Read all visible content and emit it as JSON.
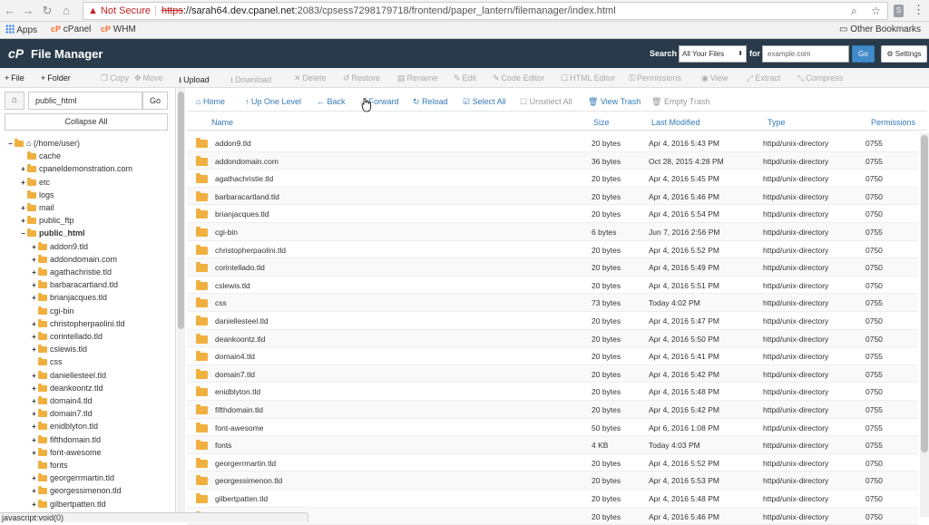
{
  "browser": {
    "warning": "Not Secure",
    "url_scheme": "https",
    "url_host": "://sarah64.dev.cpanel.net",
    "url_rest": ":2083/cpsess7298179718/frontend/paper_lantern/filemanager/index.html",
    "bookmarks": {
      "apps": "Apps",
      "cpanel": "cPanel",
      "whm": "WHM",
      "other": "Other Bookmarks"
    }
  },
  "header": {
    "logo": "cP",
    "title": "File Manager",
    "search_label": "Search",
    "search_scope": "All Your Files",
    "for_label": "for",
    "search_placeholder": "example.com",
    "go_label": "Go",
    "settings_label": "Settings"
  },
  "toolbar": {
    "items": [
      {
        "label": "File",
        "icon": "+",
        "enabled": true
      },
      {
        "label": "Folder",
        "icon": "+",
        "enabled": true
      },
      {
        "label": "Copy",
        "icon": "❐",
        "enabled": false
      },
      {
        "label": "Move",
        "icon": "✥",
        "enabled": false
      },
      {
        "label": "Upload",
        "icon": "⭳",
        "enabled": true
      },
      {
        "label": "Download",
        "icon": "⭳",
        "enabled": false
      },
      {
        "label": "Delete",
        "icon": "✕",
        "enabled": false
      },
      {
        "label": "Restore",
        "icon": "↺",
        "enabled": false
      },
      {
        "label": "Rename",
        "icon": "▤",
        "enabled": false
      },
      {
        "label": "Edit",
        "icon": "✎",
        "enabled": false
      },
      {
        "label": "Code Editor",
        "icon": "✎",
        "enabled": false
      },
      {
        "label": "HTML Editor",
        "icon": "☐",
        "enabled": false
      },
      {
        "label": "Permissions",
        "icon": "⚿",
        "enabled": false
      },
      {
        "label": "View",
        "icon": "◉",
        "enabled": false
      },
      {
        "label": "Extract",
        "icon": "⤢",
        "enabled": false
      },
      {
        "label": "Compress",
        "icon": "⤡",
        "enabled": false
      }
    ]
  },
  "sidebar": {
    "path_value": "public_html",
    "go_label": "Go",
    "collapse_label": "Collapse All",
    "tree": [
      {
        "label": "(/home/user)",
        "level": 0,
        "toggle": "−",
        "home": true
      },
      {
        "label": "cache",
        "level": 1,
        "toggle": ""
      },
      {
        "label": "cpaneldemonstration.com",
        "level": 1,
        "toggle": "+"
      },
      {
        "label": "etc",
        "level": 1,
        "toggle": "+"
      },
      {
        "label": "logs",
        "level": 1,
        "toggle": ""
      },
      {
        "label": "mail",
        "level": 1,
        "toggle": "+"
      },
      {
        "label": "public_ftp",
        "level": 1,
        "toggle": "+"
      },
      {
        "label": "public_html",
        "level": 1,
        "toggle": "−",
        "bold": true
      },
      {
        "label": "addon9.tld",
        "level": 2,
        "toggle": "+"
      },
      {
        "label": "addondomain.com",
        "level": 2,
        "toggle": "+"
      },
      {
        "label": "agathachristie.tld",
        "level": 2,
        "toggle": "+"
      },
      {
        "label": "barbaracartland.tld",
        "level": 2,
        "toggle": "+"
      },
      {
        "label": "brianjacques.tld",
        "level": 2,
        "toggle": "+"
      },
      {
        "label": "cgi-bin",
        "level": 2,
        "toggle": ""
      },
      {
        "label": "christopherpaolini.tld",
        "level": 2,
        "toggle": "+"
      },
      {
        "label": "corintellado.tld",
        "level": 2,
        "toggle": "+"
      },
      {
        "label": "cslewis.tld",
        "level": 2,
        "toggle": "+"
      },
      {
        "label": "css",
        "level": 2,
        "toggle": ""
      },
      {
        "label": "daniellesteel.tld",
        "level": 2,
        "toggle": "+"
      },
      {
        "label": "deankoontz.tld",
        "level": 2,
        "toggle": "+"
      },
      {
        "label": "domain4.tld",
        "level": 2,
        "toggle": "+"
      },
      {
        "label": "domain7.tld",
        "level": 2,
        "toggle": "+"
      },
      {
        "label": "enidblyton.tld",
        "level": 2,
        "toggle": "+"
      },
      {
        "label": "fifthdomain.tld",
        "level": 2,
        "toggle": "+"
      },
      {
        "label": "font-awesome",
        "level": 2,
        "toggle": "+"
      },
      {
        "label": "fonts",
        "level": 2,
        "toggle": ""
      },
      {
        "label": "georgerrmartin.tld",
        "level": 2,
        "toggle": "+"
      },
      {
        "label": "georgessimenon.tld",
        "level": 2,
        "toggle": "+"
      },
      {
        "label": "gilbertpatten.tld",
        "level": 2,
        "toggle": "+"
      }
    ]
  },
  "subbar": {
    "home": "Home",
    "up": "Up One Level",
    "back": "Back",
    "forward": "Forward",
    "reload": "Reload",
    "select_all": "Select All",
    "unselect_all": "Unselect All",
    "view_trash": "View Trash",
    "empty_trash": "Empty Trash"
  },
  "table": {
    "headers": {
      "name": "Name",
      "size": "Size",
      "modified": "Last Modified",
      "type": "Type",
      "perms": "Permissions"
    },
    "rows": [
      {
        "name": "addon9.tld",
        "size": "20 bytes",
        "modified": "Apr 4, 2016 5:43 PM",
        "type": "httpd/unix-directory",
        "perms": "0755"
      },
      {
        "name": "addondomain.com",
        "size": "36 bytes",
        "modified": "Oct 28, 2015 4:28 PM",
        "type": "httpd/unix-directory",
        "perms": "0755"
      },
      {
        "name": "agathachristie.tld",
        "size": "20 bytes",
        "modified": "Apr 4, 2016 5:45 PM",
        "type": "httpd/unix-directory",
        "perms": "0750"
      },
      {
        "name": "barbaracartland.tld",
        "size": "20 bytes",
        "modified": "Apr 4, 2016 5:46 PM",
        "type": "httpd/unix-directory",
        "perms": "0750"
      },
      {
        "name": "brianjacques.tld",
        "size": "20 bytes",
        "modified": "Apr 4, 2016 5:54 PM",
        "type": "httpd/unix-directory",
        "perms": "0750"
      },
      {
        "name": "cgi-bin",
        "size": "6 bytes",
        "modified": "Jun 7, 2016 2:56 PM",
        "type": "httpd/unix-directory",
        "perms": "0755"
      },
      {
        "name": "christopherpaolini.tld",
        "size": "20 bytes",
        "modified": "Apr 4, 2016 5:52 PM",
        "type": "httpd/unix-directory",
        "perms": "0750"
      },
      {
        "name": "corintellado.tld",
        "size": "20 bytes",
        "modified": "Apr 4, 2016 5:49 PM",
        "type": "httpd/unix-directory",
        "perms": "0750"
      },
      {
        "name": "cslewis.tld",
        "size": "20 bytes",
        "modified": "Apr 4, 2016 5:51 PM",
        "type": "httpd/unix-directory",
        "perms": "0750"
      },
      {
        "name": "css",
        "size": "73 bytes",
        "modified": "Today 4:02 PM",
        "type": "httpd/unix-directory",
        "perms": "0755"
      },
      {
        "name": "daniellesteel.tld",
        "size": "20 bytes",
        "modified": "Apr 4, 2016 5:47 PM",
        "type": "httpd/unix-directory",
        "perms": "0750"
      },
      {
        "name": "deankoontz.tld",
        "size": "20 bytes",
        "modified": "Apr 4, 2016 5:50 PM",
        "type": "httpd/unix-directory",
        "perms": "0750"
      },
      {
        "name": "domain4.tld",
        "size": "20 bytes",
        "modified": "Apr 4, 2016 5:41 PM",
        "type": "httpd/unix-directory",
        "perms": "0755"
      },
      {
        "name": "domain7.tld",
        "size": "20 bytes",
        "modified": "Apr 4, 2016 5:42 PM",
        "type": "httpd/unix-directory",
        "perms": "0755"
      },
      {
        "name": "enidblyton.tld",
        "size": "20 bytes",
        "modified": "Apr 4, 2016 5:48 PM",
        "type": "httpd/unix-directory",
        "perms": "0750"
      },
      {
        "name": "fifthdomain.tld",
        "size": "20 bytes",
        "modified": "Apr 4, 2016 5:42 PM",
        "type": "httpd/unix-directory",
        "perms": "0755"
      },
      {
        "name": "font-awesome",
        "size": "50 bytes",
        "modified": "Apr 6, 2016 1:08 PM",
        "type": "httpd/unix-directory",
        "perms": "0755"
      },
      {
        "name": "fonts",
        "size": "4 KB",
        "modified": "Today 4:03 PM",
        "type": "httpd/unix-directory",
        "perms": "0755"
      },
      {
        "name": "georgerrmartin.tld",
        "size": "20 bytes",
        "modified": "Apr 4, 2016 5:52 PM",
        "type": "httpd/unix-directory",
        "perms": "0750"
      },
      {
        "name": "georgessimenon.tld",
        "size": "20 bytes",
        "modified": "Apr 4, 2016 5:53 PM",
        "type": "httpd/unix-directory",
        "perms": "0750"
      },
      {
        "name": "gilbertpatten.tld",
        "size": "20 bytes",
        "modified": "Apr 4, 2016 5:48 PM",
        "type": "httpd/unix-directory",
        "perms": "0750"
      },
      {
        "name": "",
        "size": "20 bytes",
        "modified": "Apr 4, 2016 5:46 PM",
        "type": "httpd/unix-directory",
        "perms": "0750"
      }
    ]
  },
  "status_bar": "javascript:void(0)",
  "colors": {
    "topbar": "#293a4a",
    "link": "#337ab7",
    "folder": "#f0b040",
    "warning": "#c5221f"
  }
}
